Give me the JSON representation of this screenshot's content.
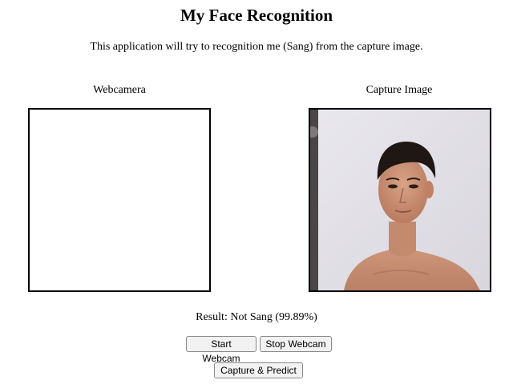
{
  "page": {
    "title": "My Face Recognition",
    "subtitle": "This application will try to recognition me (Sang) from the capture image."
  },
  "webcam": {
    "label": "Webcamera"
  },
  "capture": {
    "label": "Capture Image"
  },
  "result": {
    "text": "Result: Not Sang (99.89%)"
  },
  "buttons": {
    "start_webcam": "Start Webcam",
    "stop_webcam": "Stop Webcam",
    "capture_predict": "Capture & Predict"
  }
}
